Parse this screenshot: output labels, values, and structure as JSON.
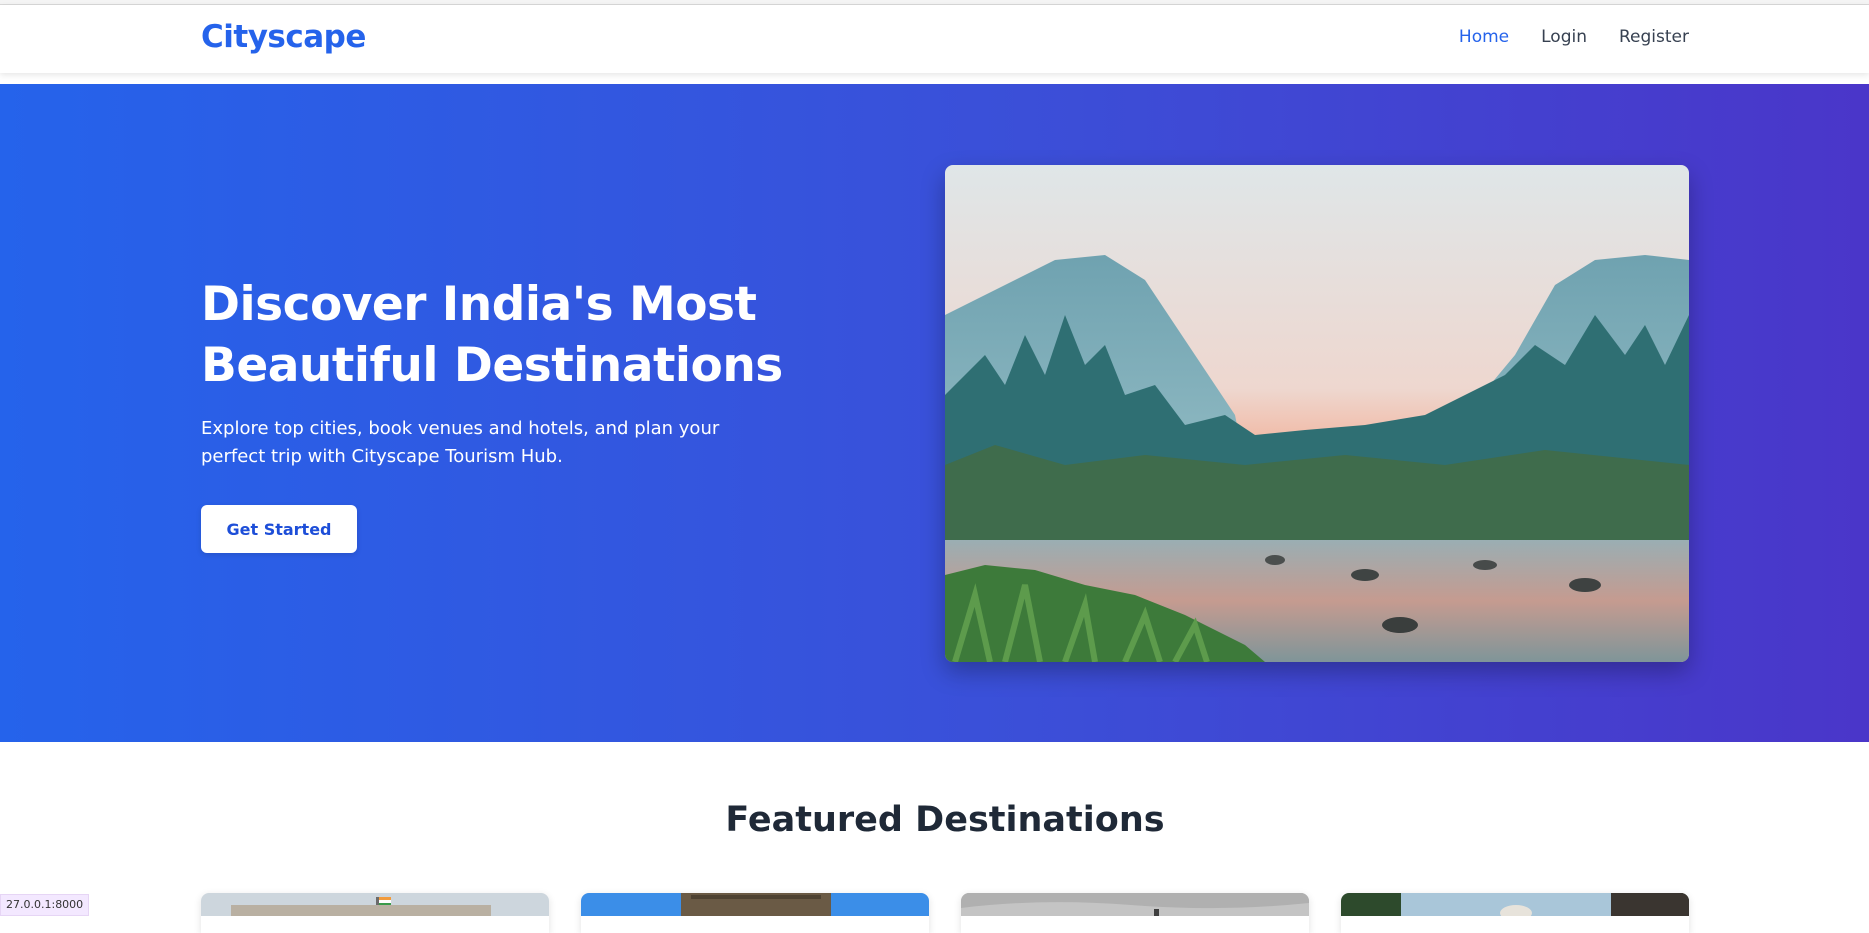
{
  "nav": {
    "brand": "Cityscape",
    "links": [
      {
        "label": "Home",
        "active": true
      },
      {
        "label": "Login",
        "active": false
      },
      {
        "label": "Register",
        "active": false
      }
    ]
  },
  "hero": {
    "title": "Discover India's Most Beautiful Destinations",
    "subtitle": "Explore top cities, book venues and hotels, and plan your perfect trip with Cityscape Tourism Hub.",
    "cta_label": "Get Started",
    "image": "mountain-valley-river-landscape"
  },
  "featured": {
    "title": "Featured Destinations",
    "cards": [
      {
        "image": "parliament-building-with-flag"
      },
      {
        "image": "gateway-monument-blue-sky"
      },
      {
        "image": "palace-cloudy-sky"
      },
      {
        "image": "taj-mahal-arch-view"
      }
    ]
  },
  "status_bar": {
    "url": "27.0.0.1:8000"
  },
  "colors": {
    "brand": "#2563eb",
    "hero_gradient_start": "#2563eb",
    "hero_gradient_end": "#4a36c9"
  }
}
